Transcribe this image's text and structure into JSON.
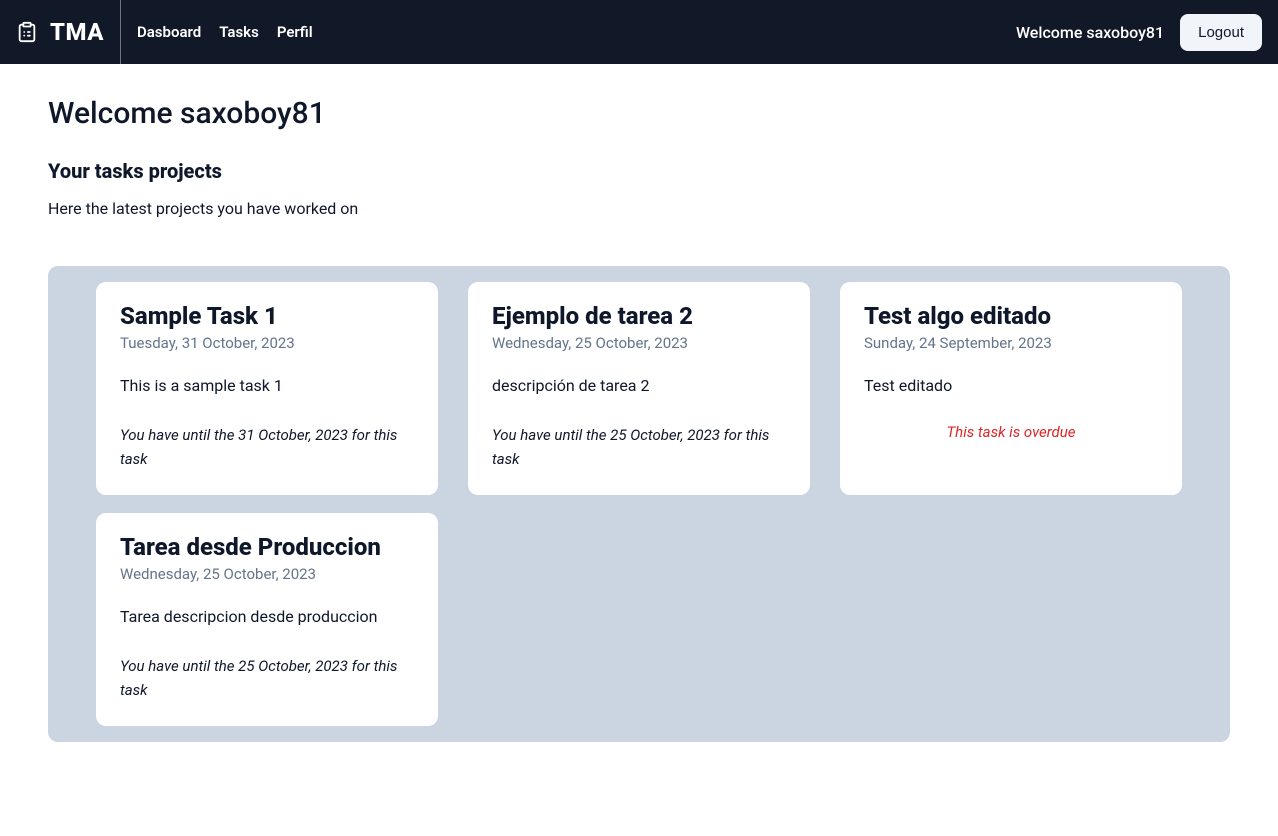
{
  "navbar": {
    "brand": "TMA",
    "links": {
      "dashboard": "Dasboard",
      "tasks": "Tasks",
      "profile": "Perfil"
    },
    "welcome": "Welcome saxoboy81",
    "logout": "Logout"
  },
  "main": {
    "title": "Welcome saxoboy81",
    "section_title": "Your tasks projects",
    "section_desc": "Here the latest projects you have worked on"
  },
  "tasks": [
    {
      "title": "Sample Task 1",
      "date": "Tuesday, 31 October, 2023",
      "desc": "This is a sample task 1",
      "deadline": "You have until the 31 October, 2023 for this task",
      "overdue": false
    },
    {
      "title": "Ejemplo de tarea 2",
      "date": "Wednesday, 25 October, 2023",
      "desc": "descripción de tarea 2",
      "deadline": "You have until the 25 October, 2023 for this task",
      "overdue": false
    },
    {
      "title": "Test algo editado",
      "date": "Sunday, 24 September, 2023",
      "desc": "Test editado",
      "deadline": "This task is overdue",
      "overdue": true
    },
    {
      "title": "Tarea desde Produccion",
      "date": "Wednesday, 25 October, 2023",
      "desc": "Tarea descripcion desde produccion",
      "deadline": "You have until the 25 October, 2023 for this task",
      "overdue": false
    }
  ]
}
